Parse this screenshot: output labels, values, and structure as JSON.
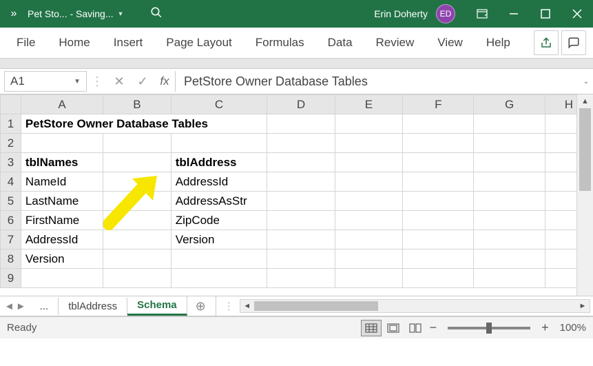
{
  "titlebar": {
    "filename": "Pet Sto...  -  Saving...",
    "user_name": "Erin Doherty",
    "user_initials": "ED"
  },
  "ribbon": {
    "tabs": [
      "File",
      "Home",
      "Insert",
      "Page Layout",
      "Formulas",
      "Data",
      "Review",
      "View",
      "Help"
    ]
  },
  "formula_bar": {
    "cell_ref": "A1",
    "fx": "fx",
    "content": "PetStore Owner Database Tables"
  },
  "columns": [
    "A",
    "B",
    "C",
    "D",
    "E",
    "F",
    "G",
    "H"
  ],
  "rows": [
    {
      "n": "1",
      "A": "PetStore Owner Database Tables",
      "A_bold": true
    },
    {
      "n": "2"
    },
    {
      "n": "3",
      "A": "tblNames",
      "A_bold": true,
      "C": "tblAddress",
      "C_bold": true
    },
    {
      "n": "4",
      "A": "NameId",
      "C": "AddressId"
    },
    {
      "n": "5",
      "A": "LastName",
      "C": "AddressAsStr"
    },
    {
      "n": "6",
      "A": "FirstName",
      "C": "ZipCode"
    },
    {
      "n": "7",
      "A": "AddressId",
      "C": "Version"
    },
    {
      "n": "8",
      "A": "Version"
    },
    {
      "n": "9"
    }
  ],
  "sheet_tabs": {
    "inactive": "tblAddress",
    "active": "Schema",
    "ellipsis": "..."
  },
  "statusbar": {
    "status": "Ready",
    "zoom": "100%"
  }
}
